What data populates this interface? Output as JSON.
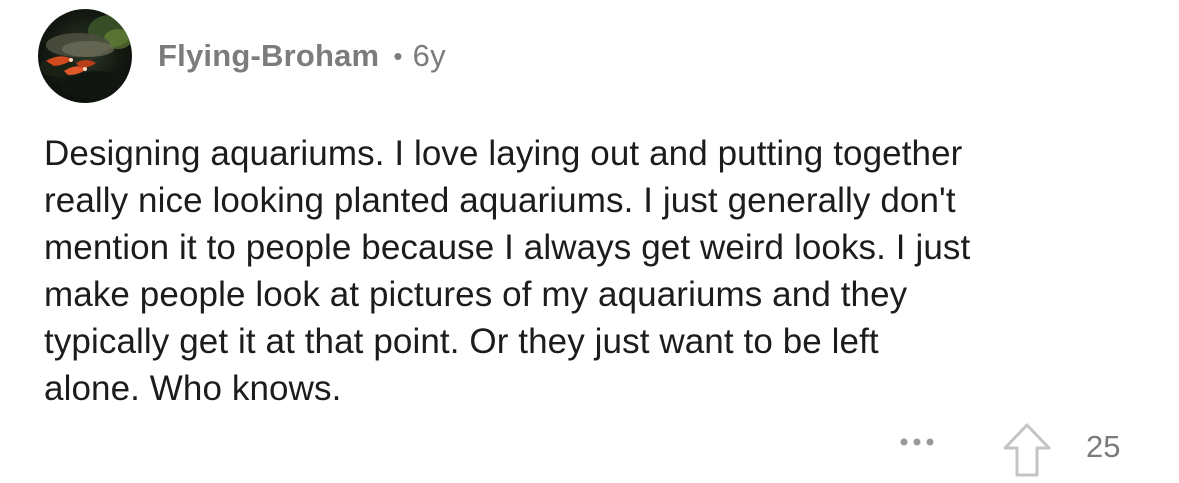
{
  "comment": {
    "author": "Flying-Broham",
    "separator": "•",
    "age": "6y",
    "text": "Designing aquariums. I love laying out and putting together\nreally nice looking planted aquariums. I just generally don't\nmention it to people because I always get weird looks. I just\nmake people look at pictures of my aquariums and they\ntypically get it at that point. Or they just want to be left\nalone. Who knows.",
    "score": "25"
  },
  "icons": {
    "avatar": "aquarium-shrimp-avatar",
    "more": "more-options-icon",
    "upvote": "upvote-arrow-icon"
  },
  "colors": {
    "meta_text": "#7c7c7c",
    "body_text": "#1c1c1c",
    "icon": "#b8b8b8"
  }
}
